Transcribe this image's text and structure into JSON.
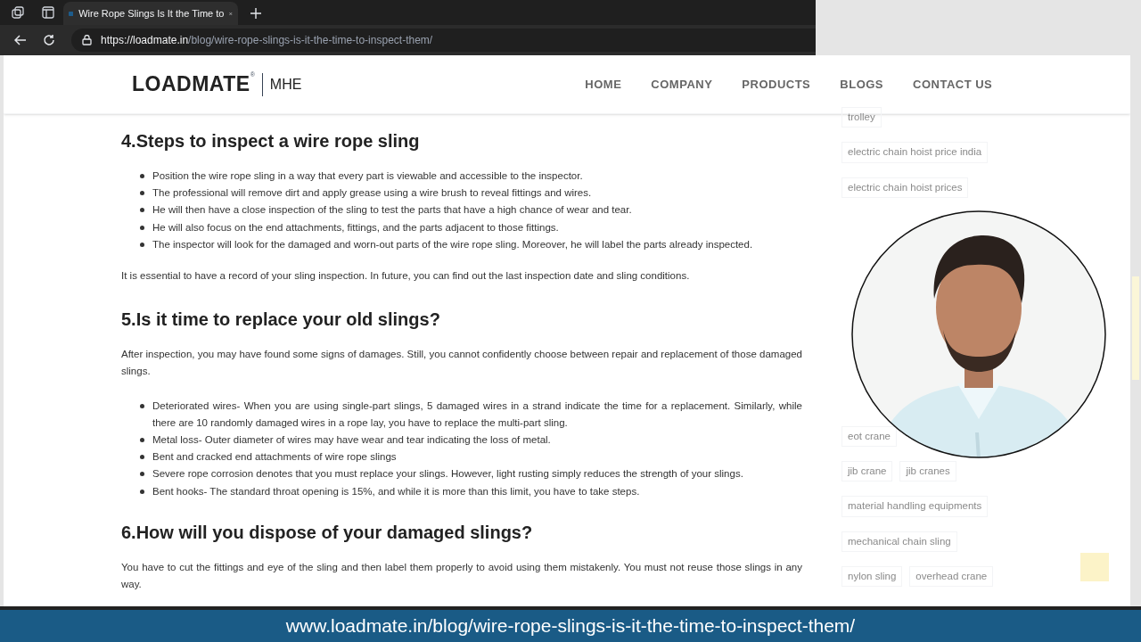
{
  "browser": {
    "tab_title": "Wire Rope Slings Is It the Time to",
    "url_host": "https://loadmate.in",
    "url_path": "/blog/wire-rope-slings-is-it-the-time-to-inspect-them/"
  },
  "site": {
    "logo": "LOADMATE",
    "logo_mark": "®",
    "logo_sub": "MHE",
    "nav": [
      "HOME",
      "COMPANY",
      "PRODUCTS",
      "BLOGS",
      "CONTACT US"
    ]
  },
  "article": [
    {
      "heading": "4.Steps to inspect a wire rope sling",
      "blocks": [
        {
          "kind": "list",
          "items": [
            "Position the wire rope sling in a way that every part is viewable and accessible to the inspector.",
            "The professional will remove dirt and apply grease using a wire brush to reveal fittings and wires.",
            "He will then have a close inspection of the sling to test the parts that have a high chance of wear and tear.",
            "He will also focus on the end attachments, fittings, and the parts adjacent to those fittings.",
            "The inspector will look for the damaged and worn-out parts of the wire rope sling. Moreover, he will label the parts already inspected."
          ]
        },
        {
          "kind": "paragraph",
          "text": "It is essential to have a record of your sling inspection. In future, you can find out the last inspection date and sling conditions."
        }
      ]
    },
    {
      "heading": "5.Is it time to replace your old slings?",
      "blocks": [
        {
          "kind": "paragraph",
          "text": "After inspection, you may have found some signs of damages. Still, you cannot confidently choose between repair and replacement of those damaged slings."
        },
        {
          "kind": "list",
          "items": [
            "Deteriorated wires- When you are using single-part slings, 5 damaged wires in a strand indicate the time for a replacement. Similarly, while there are 10 randomly damaged wires in a rope lay, you have to replace the multi-part sling.",
            "Metal loss- Outer diameter of wires may have wear and tear indicating the loss of metal.",
            "Bent and cracked end attachments of wire rope slings",
            "Severe rope corrosion denotes that you must replace your slings. However, light rusting simply reduces the strength of your slings.",
            "Bent hooks- The standard throat opening is 15%, and while it is more than this limit, you have to take steps."
          ]
        }
      ]
    },
    {
      "heading": "6.How will you dispose of your damaged slings?",
      "blocks": [
        {
          "kind": "paragraph",
          "text": "You have to cut the fittings and eye of the sling and then label them properly to avoid using them mistakenly. You must not reuse those slings in any way."
        }
      ]
    }
  ],
  "sidebar_tags": [
    [
      "trolley"
    ],
    [
      "electric chain hoist price india"
    ],
    [
      "electric chain hoist prices"
    ],
    [
      "eot crane"
    ],
    [
      "jib crane",
      "jib cranes"
    ],
    [
      "material handling equipments"
    ],
    [
      "mechanical chain sling"
    ],
    [
      "nylon sling",
      "overhead crane"
    ]
  ],
  "video": {
    "kind": "picture"
  },
  "banner": "www.loadmate.in/blog/wire-rope-slings-is-it-the-time-to-inspect-them/"
}
